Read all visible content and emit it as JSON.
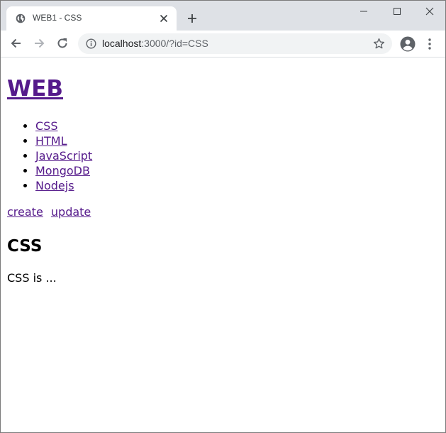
{
  "browser": {
    "tab": {
      "title": "WEB1 - CSS"
    },
    "address_bar": {
      "url_host": "localhost",
      "url_rest": ":3000/?id=CSS"
    }
  },
  "page": {
    "site_title": "WEB",
    "nav": [
      {
        "label": "CSS"
      },
      {
        "label": "HTML"
      },
      {
        "label": "JavaScript"
      },
      {
        "label": "MongoDB"
      },
      {
        "label": "Nodejs"
      }
    ],
    "controls": {
      "create": "create",
      "update": "update"
    },
    "doc_title": "CSS",
    "doc_description": "CSS is ..."
  },
  "icons": {
    "tab_favicon": "globe-icon",
    "tab_close": "close-icon",
    "new_tab": "plus-icon",
    "minimize": "minimize-icon",
    "maximize": "maximize-icon",
    "close_window": "close-icon",
    "back": "arrow-left-icon",
    "forward": "arrow-right-icon",
    "reload": "reload-icon",
    "site_info": "info-icon",
    "bookmark": "star-icon",
    "profile": "account-circle-icon",
    "menu": "kebab-menu-icon"
  },
  "colors": {
    "tabstrip_bg": "#dee1e6",
    "omnibox_bg": "#f1f3f4",
    "link_visited": "#551a8b",
    "disabled_icon": "#b0b3b8",
    "icon": "#5f6368"
  }
}
